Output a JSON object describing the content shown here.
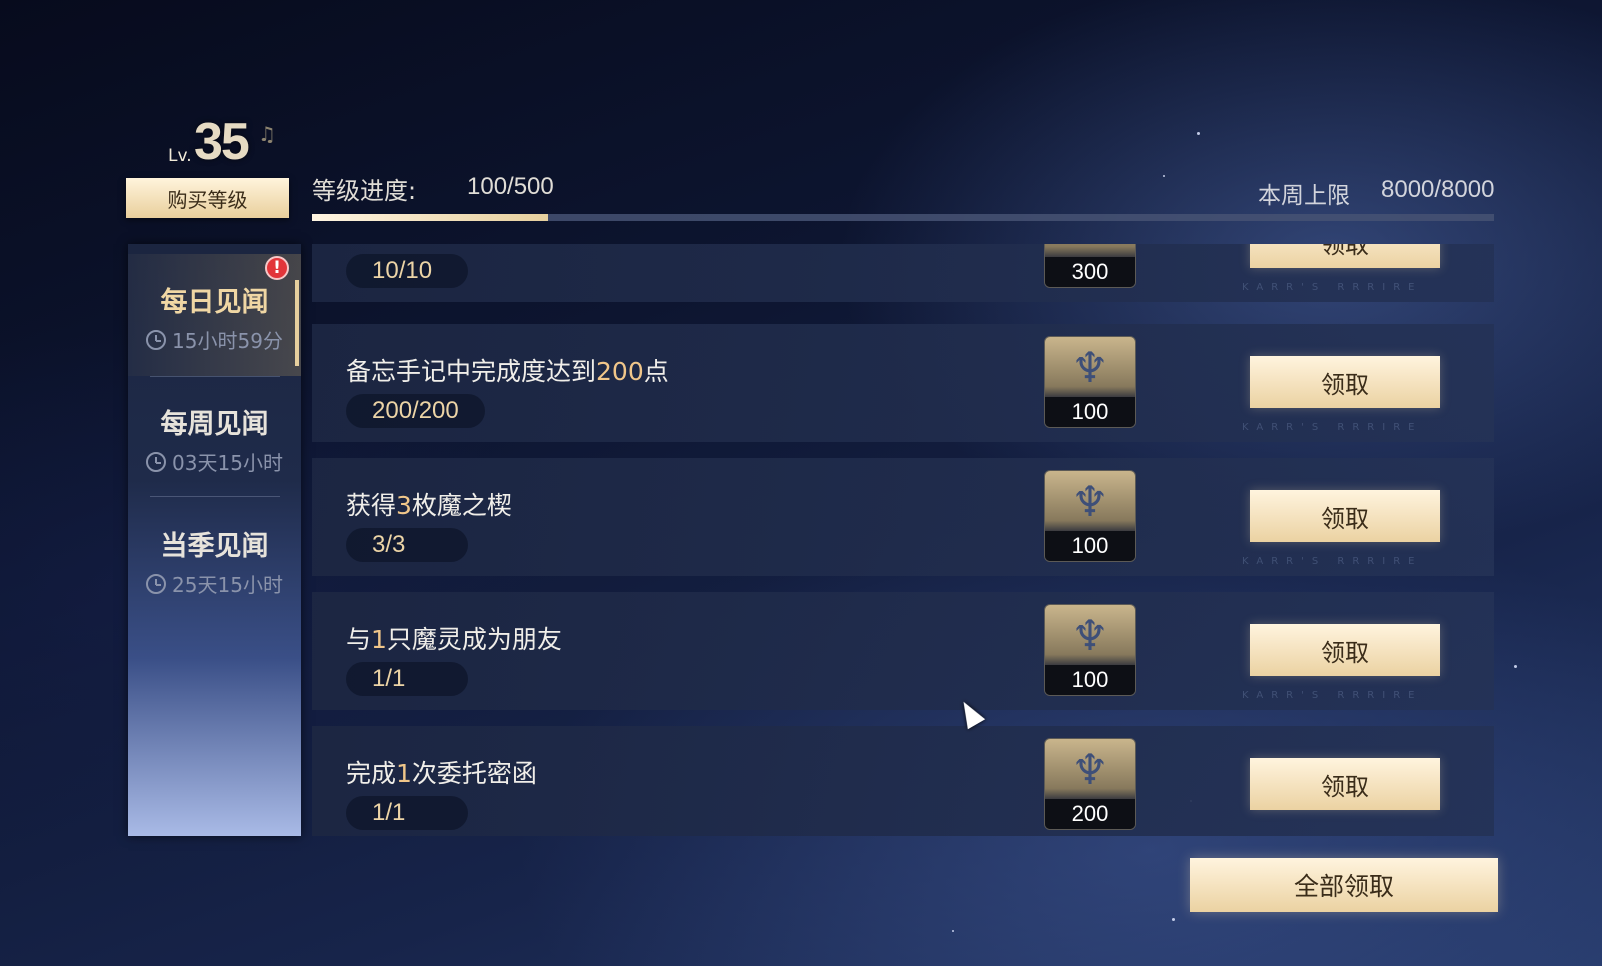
{
  "level": {
    "prefix": "Lv.",
    "value": "35"
  },
  "buy_level_label": "购买等级",
  "progress": {
    "label": "等级进度:",
    "value_text": "100/500",
    "current": 100,
    "max": 500,
    "fill_fraction": 0.2
  },
  "weekly_limit": {
    "label": "本周上限",
    "value_text": "8000/8000"
  },
  "sidebar": {
    "alert_badge": "!",
    "tabs": [
      {
        "title": "每日见闻",
        "time": "15小时59分",
        "active": true
      },
      {
        "title": "每周见闻",
        "time": "03天15小时",
        "active": false
      },
      {
        "title": "当季见闻",
        "time": "25天15小时",
        "active": false
      }
    ]
  },
  "tasks": [
    {
      "title_parts": [],
      "count": "10/10",
      "reward": "300",
      "claim_label": "领取"
    },
    {
      "title_parts": [
        "备忘手记中完成度达到",
        "200",
        "点"
      ],
      "count": "200/200",
      "reward": "100",
      "claim_label": "领取"
    },
    {
      "title_parts": [
        "获得",
        "3",
        "枚魔之楔"
      ],
      "count": "3/3",
      "reward": "100",
      "claim_label": "领取"
    },
    {
      "title_parts": [
        "与",
        "1",
        "只魔灵成为朋友"
      ],
      "count": "1/1",
      "reward": "100",
      "claim_label": "领取"
    },
    {
      "title_parts": [
        "完成",
        "1",
        "次委托密函"
      ],
      "count": "1/1",
      "reward": "200",
      "claim_label": "领取"
    }
  ],
  "watermark_text": "KARR'S RRRIRE",
  "claim_all_label": "全部领取",
  "colors": {
    "accent_gold": "#ebd2a2",
    "highlight": "#f0c68a",
    "alert": "#e2353a",
    "panel": "#1c2642"
  },
  "icons": {
    "reward": "lyre-icon",
    "timer": "clock-icon",
    "level": "music-note-icon"
  }
}
